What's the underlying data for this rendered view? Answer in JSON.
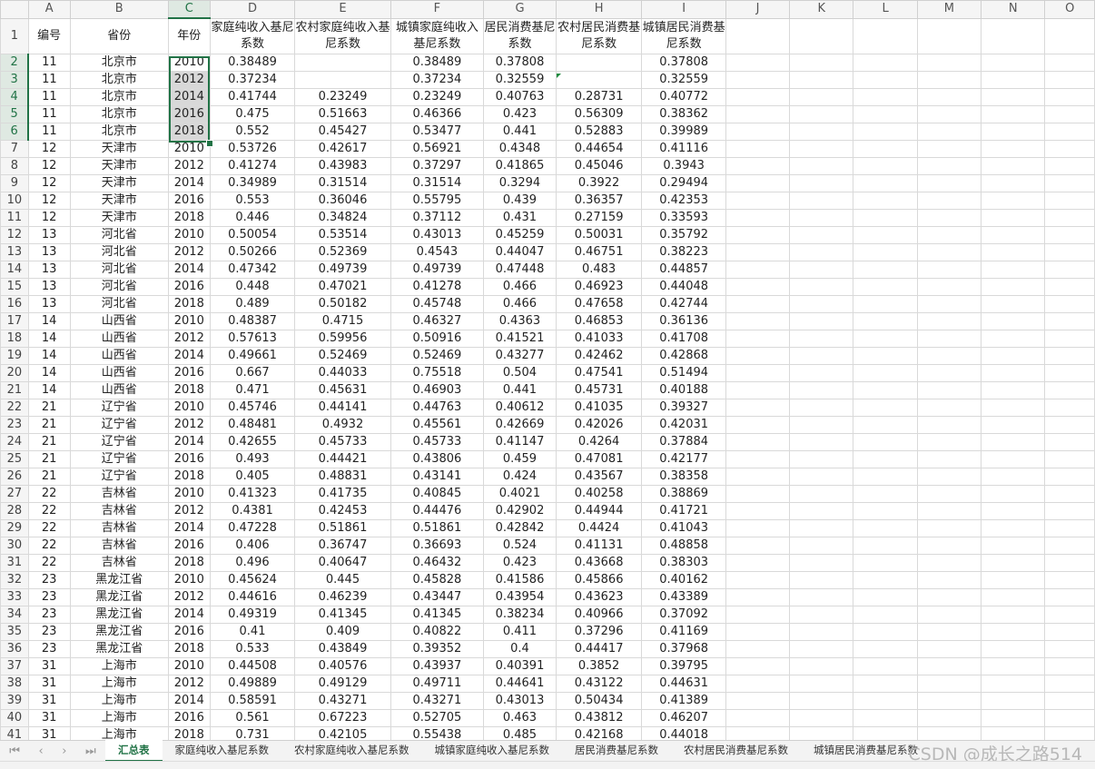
{
  "columns": [
    "A",
    "B",
    "C",
    "D",
    "E",
    "F",
    "G",
    "H",
    "I",
    "J",
    "K",
    "L",
    "M",
    "N",
    "O"
  ],
  "selected_column": "C",
  "header_row": [
    "编号",
    "省份",
    "年份",
    "家庭纯收入基尼系数",
    "农村家庭纯收入基尼系数",
    "城镇家庭纯收入基尼系数",
    "居民消费基尼系数",
    "农村居民消费基尼系数",
    "城镇居民消费基尼系数"
  ],
  "rows": [
    [
      "11",
      "北京市",
      "2010",
      "0.38489",
      "",
      "0.38489",
      "0.37808",
      "",
      "0.37808"
    ],
    [
      "11",
      "北京市",
      "2012",
      "0.37234",
      "",
      "0.37234",
      "0.32559",
      "",
      "0.32559"
    ],
    [
      "11",
      "北京市",
      "2014",
      "0.41744",
      "0.23249",
      "0.23249",
      "0.40763",
      "0.28731",
      "0.40772"
    ],
    [
      "11",
      "北京市",
      "2016",
      "0.475",
      "0.51663",
      "0.46366",
      "0.423",
      "0.56309",
      "0.38362"
    ],
    [
      "11",
      "北京市",
      "2018",
      "0.552",
      "0.45427",
      "0.53477",
      "0.441",
      "0.52883",
      "0.39989"
    ],
    [
      "12",
      "天津市",
      "2010",
      "0.53726",
      "0.42617",
      "0.56921",
      "0.4348",
      "0.44654",
      "0.41116"
    ],
    [
      "12",
      "天津市",
      "2012",
      "0.41274",
      "0.43983",
      "0.37297",
      "0.41865",
      "0.45046",
      "0.3943"
    ],
    [
      "12",
      "天津市",
      "2014",
      "0.34989",
      "0.31514",
      "0.31514",
      "0.3294",
      "0.3922",
      "0.29494"
    ],
    [
      "12",
      "天津市",
      "2016",
      "0.553",
      "0.36046",
      "0.55795",
      "0.439",
      "0.36357",
      "0.42353"
    ],
    [
      "12",
      "天津市",
      "2018",
      "0.446",
      "0.34824",
      "0.37112",
      "0.431",
      "0.27159",
      "0.33593"
    ],
    [
      "13",
      "河北省",
      "2010",
      "0.50054",
      "0.53514",
      "0.43013",
      "0.45259",
      "0.50031",
      "0.35792"
    ],
    [
      "13",
      "河北省",
      "2012",
      "0.50266",
      "0.52369",
      "0.4543",
      "0.44047",
      "0.46751",
      "0.38223"
    ],
    [
      "13",
      "河北省",
      "2014",
      "0.47342",
      "0.49739",
      "0.49739",
      "0.47448",
      "0.483",
      "0.44857"
    ],
    [
      "13",
      "河北省",
      "2016",
      "0.448",
      "0.47021",
      "0.41278",
      "0.466",
      "0.46923",
      "0.44048"
    ],
    [
      "13",
      "河北省",
      "2018",
      "0.489",
      "0.50182",
      "0.45748",
      "0.466",
      "0.47658",
      "0.42744"
    ],
    [
      "14",
      "山西省",
      "2010",
      "0.48387",
      "0.4715",
      "0.46327",
      "0.4363",
      "0.46853",
      "0.36136"
    ],
    [
      "14",
      "山西省",
      "2012",
      "0.57613",
      "0.59956",
      "0.50916",
      "0.41521",
      "0.41033",
      "0.41708"
    ],
    [
      "14",
      "山西省",
      "2014",
      "0.49661",
      "0.52469",
      "0.52469",
      "0.43277",
      "0.42462",
      "0.42868"
    ],
    [
      "14",
      "山西省",
      "2016",
      "0.667",
      "0.44033",
      "0.75518",
      "0.504",
      "0.47541",
      "0.51494"
    ],
    [
      "14",
      "山西省",
      "2018",
      "0.471",
      "0.45631",
      "0.46903",
      "0.441",
      "0.45731",
      "0.40188"
    ],
    [
      "21",
      "辽宁省",
      "2010",
      "0.45746",
      "0.44141",
      "0.44763",
      "0.40612",
      "0.41035",
      "0.39327"
    ],
    [
      "21",
      "辽宁省",
      "2012",
      "0.48481",
      "0.4932",
      "0.45561",
      "0.42669",
      "0.42026",
      "0.42031"
    ],
    [
      "21",
      "辽宁省",
      "2014",
      "0.42655",
      "0.45733",
      "0.45733",
      "0.41147",
      "0.4264",
      "0.37884"
    ],
    [
      "21",
      "辽宁省",
      "2016",
      "0.493",
      "0.44421",
      "0.43806",
      "0.459",
      "0.47081",
      "0.42177"
    ],
    [
      "21",
      "辽宁省",
      "2018",
      "0.405",
      "0.48831",
      "0.43141",
      "0.424",
      "0.43567",
      "0.38358"
    ],
    [
      "22",
      "吉林省",
      "2010",
      "0.41323",
      "0.41735",
      "0.40845",
      "0.4021",
      "0.40258",
      "0.38869"
    ],
    [
      "22",
      "吉林省",
      "2012",
      "0.4381",
      "0.42453",
      "0.44476",
      "0.42902",
      "0.44944",
      "0.41721"
    ],
    [
      "22",
      "吉林省",
      "2014",
      "0.47228",
      "0.51861",
      "0.51861",
      "0.42842",
      "0.4424",
      "0.41043"
    ],
    [
      "22",
      "吉林省",
      "2016",
      "0.406",
      "0.36747",
      "0.36693",
      "0.524",
      "0.41131",
      "0.48858"
    ],
    [
      "22",
      "吉林省",
      "2018",
      "0.496",
      "0.40647",
      "0.46432",
      "0.423",
      "0.43668",
      "0.38303"
    ],
    [
      "23",
      "黑龙江省",
      "2010",
      "0.45624",
      "0.445",
      "0.45828",
      "0.41586",
      "0.45866",
      "0.40162"
    ],
    [
      "23",
      "黑龙江省",
      "2012",
      "0.44616",
      "0.46239",
      "0.43447",
      "0.43954",
      "0.43623",
      "0.43389"
    ],
    [
      "23",
      "黑龙江省",
      "2014",
      "0.49319",
      "0.41345",
      "0.41345",
      "0.38234",
      "0.40966",
      "0.37092"
    ],
    [
      "23",
      "黑龙江省",
      "2016",
      "0.41",
      "0.409",
      "0.40822",
      "0.411",
      "0.37296",
      "0.41169"
    ],
    [
      "23",
      "黑龙江省",
      "2018",
      "0.533",
      "0.43849",
      "0.39352",
      "0.4",
      "0.44417",
      "0.37968"
    ],
    [
      "31",
      "上海市",
      "2010",
      "0.44508",
      "0.40576",
      "0.43937",
      "0.40391",
      "0.3852",
      "0.39795"
    ],
    [
      "31",
      "上海市",
      "2012",
      "0.49889",
      "0.49129",
      "0.49711",
      "0.44641",
      "0.43122",
      "0.44631"
    ],
    [
      "31",
      "上海市",
      "2014",
      "0.58591",
      "0.43271",
      "0.43271",
      "0.43013",
      "0.50434",
      "0.41389"
    ],
    [
      "31",
      "上海市",
      "2016",
      "0.561",
      "0.67223",
      "0.52705",
      "0.463",
      "0.43812",
      "0.46207"
    ],
    [
      "31",
      "上海市",
      "2018",
      "0.731",
      "0.42105",
      "0.55438",
      "0.485",
      "0.42168",
      "0.44018"
    ]
  ],
  "sheet_tabs": [
    "汇总表",
    "家庭纯收入基尼系数",
    "农村家庭纯收入基尼系数",
    "城镇家庭纯收入基尼系数",
    "居民消费基尼系数",
    "农村居民消费基尼系数",
    "城镇居民消费基尼系数"
  ],
  "active_tab": "汇总表",
  "nav_icons": [
    "first-sheet-icon",
    "prev-sheet-icon",
    "next-sheet-icon",
    "last-sheet-icon"
  ],
  "watermark": "CSDN @成长之路514",
  "accent_color": "#217346"
}
